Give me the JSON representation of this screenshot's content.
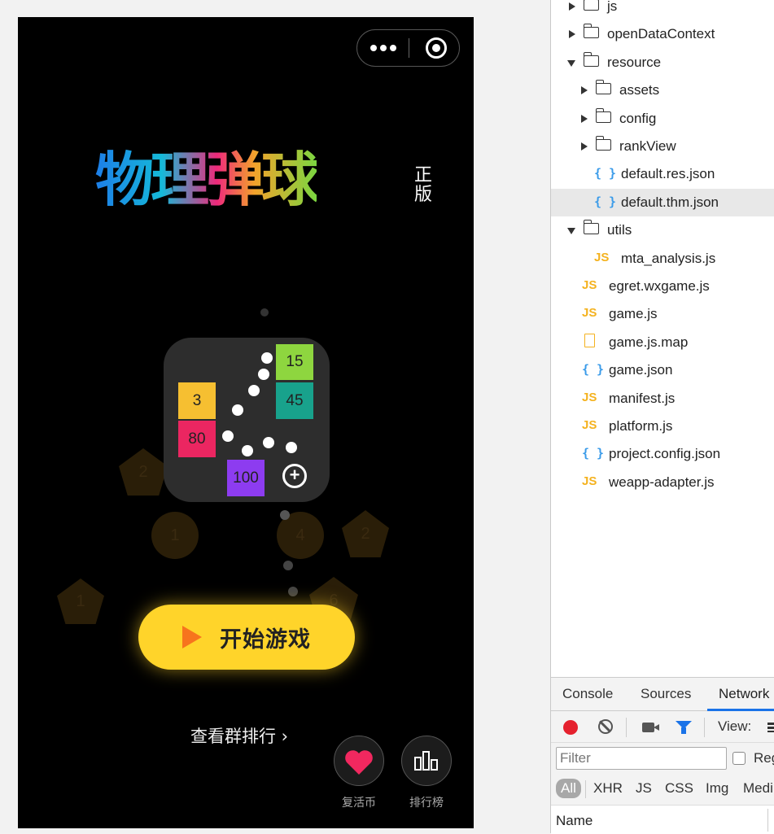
{
  "simulator": {
    "logo_text": "物理弹球",
    "logo_badge": "正版",
    "game_icon": {
      "blocks": [
        "15",
        "3",
        "45",
        "80",
        "100"
      ]
    },
    "background_numbers": [
      "2",
      "1",
      "4",
      "2",
      "1",
      "6"
    ],
    "start_button": "开始游戏",
    "group_rank_link": "查看群排行 ›",
    "revive_label": "复活币",
    "leaderboard_label": "排行榜",
    "colors": {
      "start_button": "#ffd42a",
      "play_triangle": "#f7741d",
      "heart": "#f1285f"
    }
  },
  "file_tree": [
    {
      "name": "js",
      "type": "folder",
      "expanded": false
    },
    {
      "name": "openDataContext",
      "type": "folder",
      "expanded": false
    },
    {
      "name": "resource",
      "type": "folder",
      "expanded": true
    },
    {
      "name": "assets",
      "type": "folder",
      "expanded": false
    },
    {
      "name": "config",
      "type": "folder",
      "expanded": false
    },
    {
      "name": "rankView",
      "type": "folder",
      "expanded": false
    },
    {
      "name": "default.res.json",
      "type": "json"
    },
    {
      "name": "default.thm.json",
      "type": "json",
      "selected": true
    },
    {
      "name": "utils",
      "type": "folder",
      "expanded": true
    },
    {
      "name": "mta_analysis.js",
      "type": "js"
    },
    {
      "name": "egret.wxgame.js",
      "type": "js"
    },
    {
      "name": "game.js",
      "type": "js"
    },
    {
      "name": "game.js.map",
      "type": "map"
    },
    {
      "name": "game.json",
      "type": "json"
    },
    {
      "name": "manifest.js",
      "type": "js"
    },
    {
      "name": "platform.js",
      "type": "js"
    },
    {
      "name": "project.config.json",
      "type": "json"
    },
    {
      "name": "weapp-adapter.js",
      "type": "js"
    }
  ],
  "icons": {
    "js": "JS",
    "json": "{ }"
  },
  "devtools": {
    "tabs": [
      "Console",
      "Sources",
      "Network"
    ],
    "active_tab": "Network",
    "view_label": "View:",
    "filter_placeholder": "Filter",
    "regex_label": "Reg",
    "types": [
      "All",
      "XHR",
      "JS",
      "CSS",
      "Img",
      "Medi"
    ],
    "name_column": "Name"
  }
}
